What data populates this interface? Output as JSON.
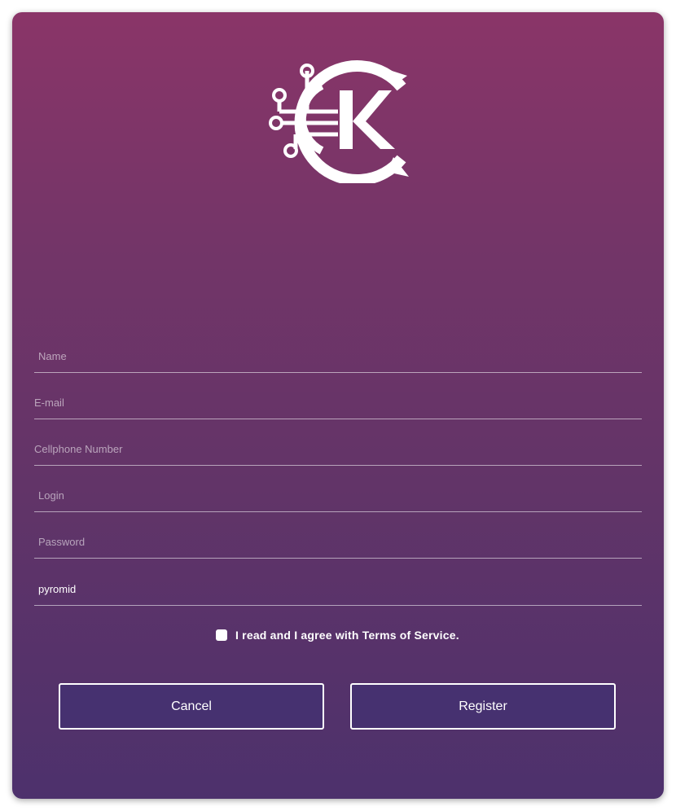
{
  "logo": {
    "letter": "K",
    "icon": "circuit-k-logo-icon",
    "color": "#ffffff"
  },
  "form": {
    "fields": [
      {
        "placeholder": "Name",
        "value": ""
      },
      {
        "placeholder": "E-mail",
        "value": ""
      },
      {
        "placeholder": "Cellphone Number",
        "value": ""
      },
      {
        "placeholder": "Login",
        "value": ""
      },
      {
        "placeholder": "Password",
        "value": ""
      },
      {
        "placeholder": "",
        "value": "pyromid"
      }
    ],
    "terms_label": "I read and I agree with Terms of Service.",
    "terms_checked": false
  },
  "buttons": {
    "cancel": "Cancel",
    "register": "Register"
  },
  "colors": {
    "gradient_top": "#8a3568",
    "gradient_bottom": "#4d316c",
    "button_fill": "#463170",
    "text": "#ffffff"
  }
}
